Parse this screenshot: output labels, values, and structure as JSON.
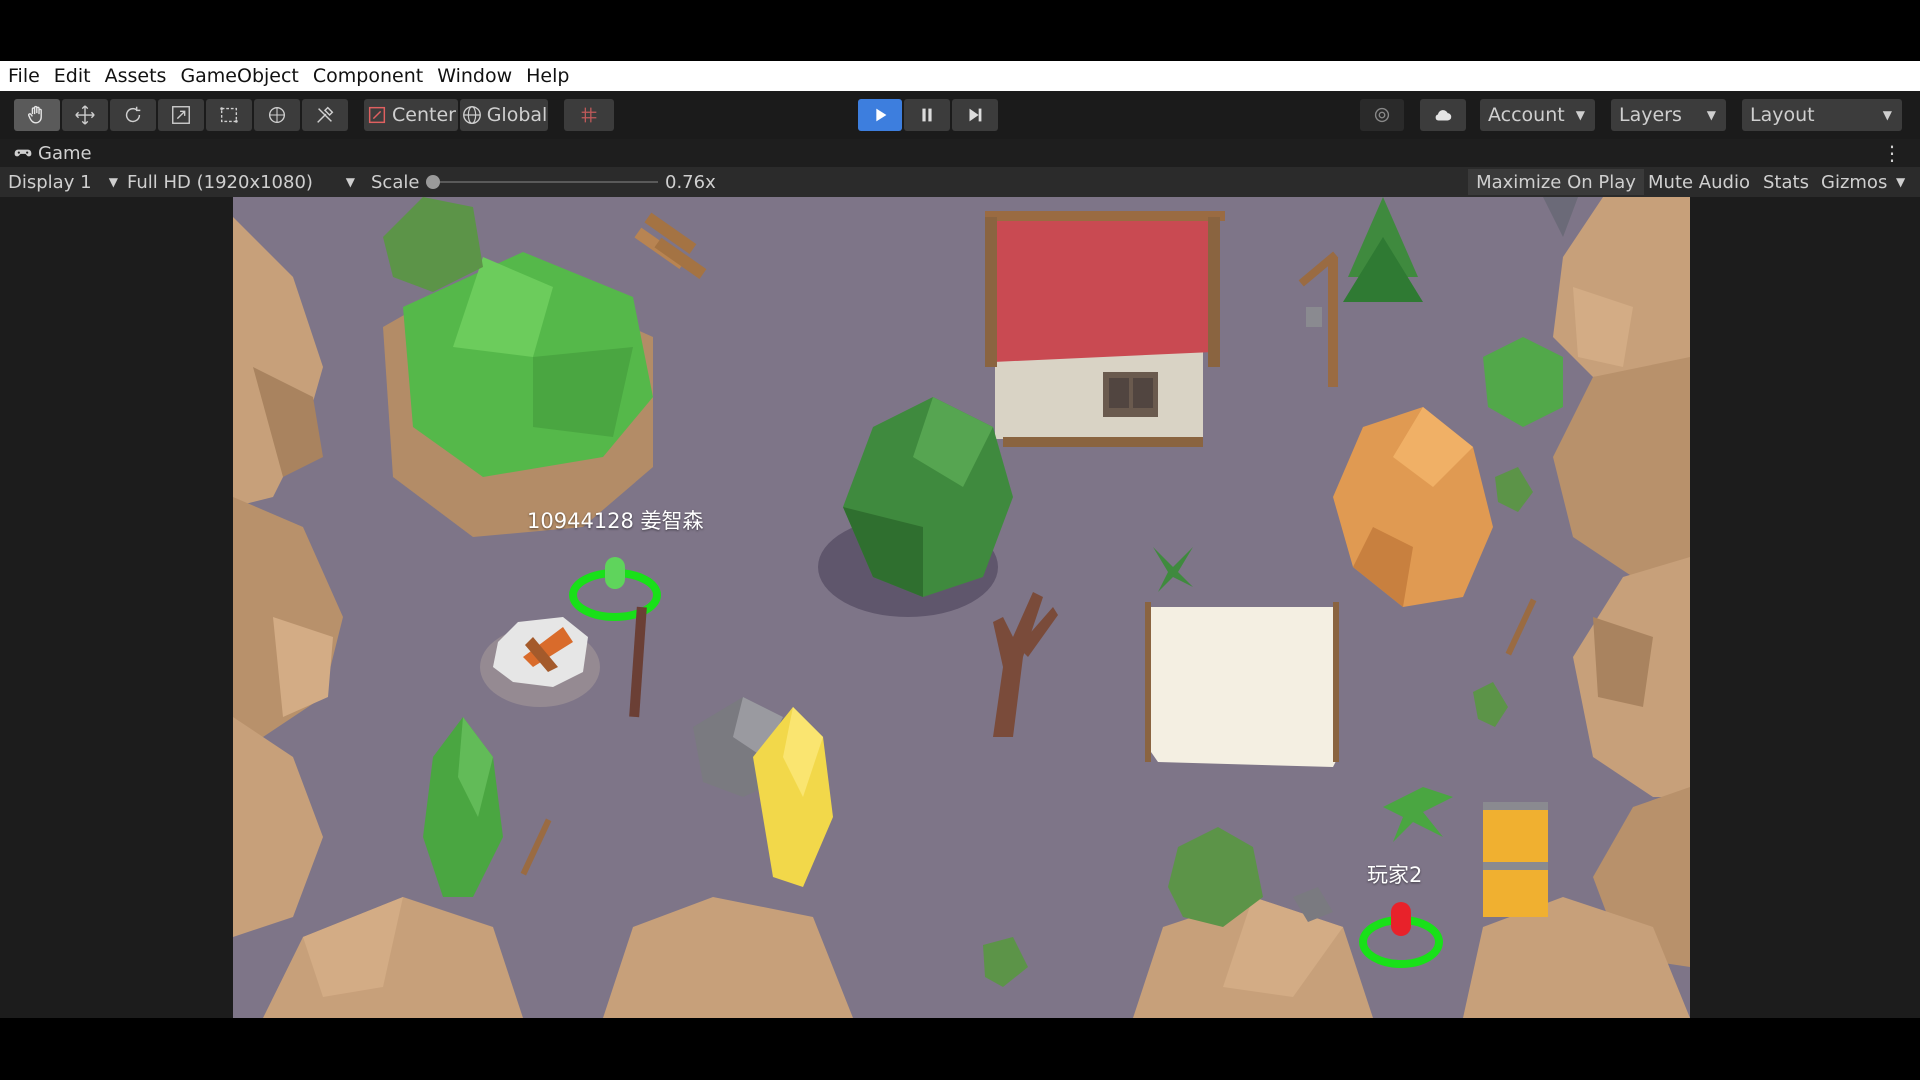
{
  "menu": {
    "items": [
      "File",
      "Edit",
      "Assets",
      "GameObject",
      "Component",
      "Window",
      "Help"
    ]
  },
  "toolbar": {
    "tools": [
      {
        "icon": "hand-icon",
        "active": true
      },
      {
        "icon": "move-icon",
        "active": false
      },
      {
        "icon": "rotate-icon",
        "active": false
      },
      {
        "icon": "scale-icon",
        "active": false
      },
      {
        "icon": "rect-icon",
        "active": false
      },
      {
        "icon": "transform-icon",
        "active": false
      },
      {
        "icon": "custom-tool-icon",
        "active": false
      }
    ],
    "pivot_label": "Center",
    "space_label": "Global",
    "snap_icon": "grid-snap-icon",
    "play_icon": "play-icon",
    "pause_icon": "pause-icon",
    "step_icon": "step-icon",
    "collab_icon": "collab-icon",
    "cloud_icon": "cloud-icon",
    "account_label": "Account",
    "layers_label": "Layers",
    "layout_label": "Layout",
    "play_color": "#3d7ede"
  },
  "game_tab": {
    "title": "Game",
    "icon": "gamepad-icon",
    "menu_icon": "kebab-menu-icon"
  },
  "game_bar": {
    "display_label": "Display 1",
    "resolution_label": "Full HD (1920x1080)",
    "scale_label": "Scale",
    "scale_value": "0.76x",
    "scale_slider_fraction": 0.0,
    "maximize_label": "Maximize On Play",
    "mute_label": "Mute Audio",
    "stats_label": "Stats",
    "gizmos_label": "Gizmos"
  },
  "scene": {
    "player1_name": "10944128 姜智森",
    "player2_name": "玩家2",
    "ground_color": "#7e7588",
    "ring_color": "#19e019"
  }
}
